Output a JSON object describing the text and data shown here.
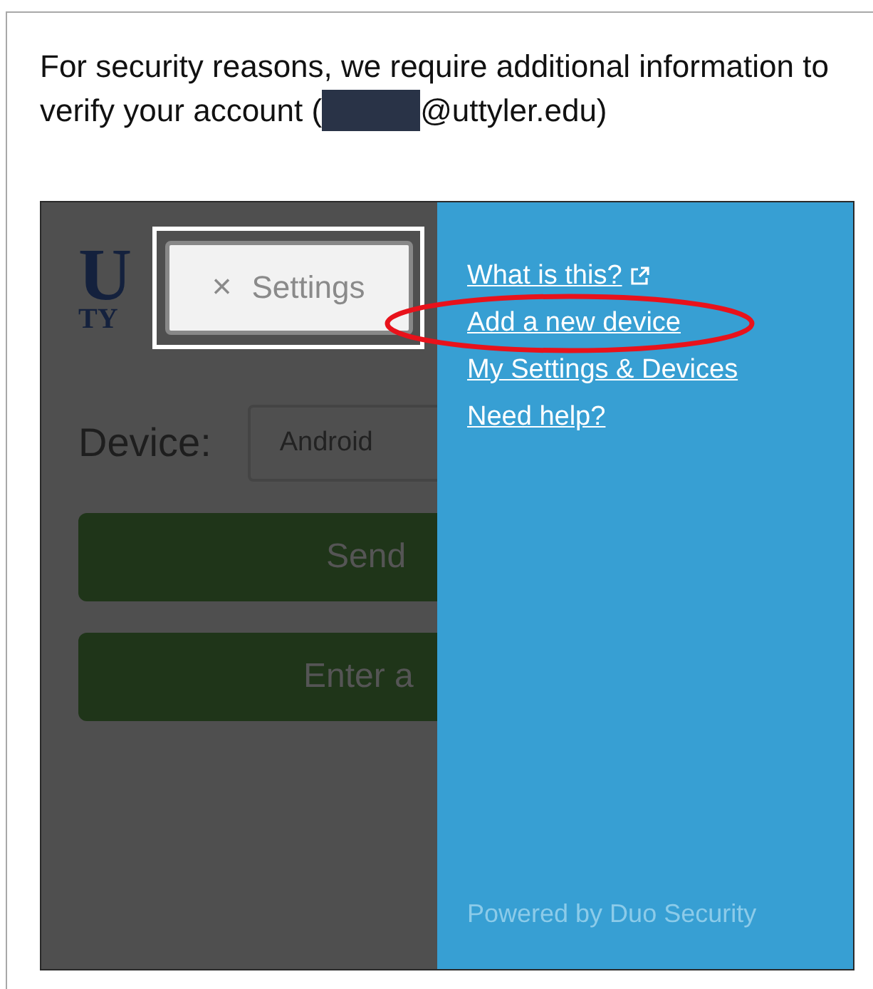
{
  "message": {
    "text_before": "For security reasons, we require additional information to verify your account (",
    "redacted": true,
    "text_after": "@uttyler.edu)"
  },
  "duo": {
    "logo": {
      "top": "U",
      "bottom": "TY"
    },
    "settings_button": {
      "icon": "×",
      "label": "Settings"
    },
    "device": {
      "label": "Device:",
      "value": "Android"
    },
    "actions": [
      "Send",
      "Enter a"
    ],
    "links": [
      {
        "label": "What is this?",
        "external": true
      },
      {
        "label": "Add a new device",
        "external": false,
        "circled": true
      },
      {
        "label": "My Settings & Devices",
        "external": false,
        "circled": false
      },
      {
        "label": "Need help?",
        "external": false,
        "circled": false
      }
    ],
    "footer": "Powered by Duo Security"
  }
}
